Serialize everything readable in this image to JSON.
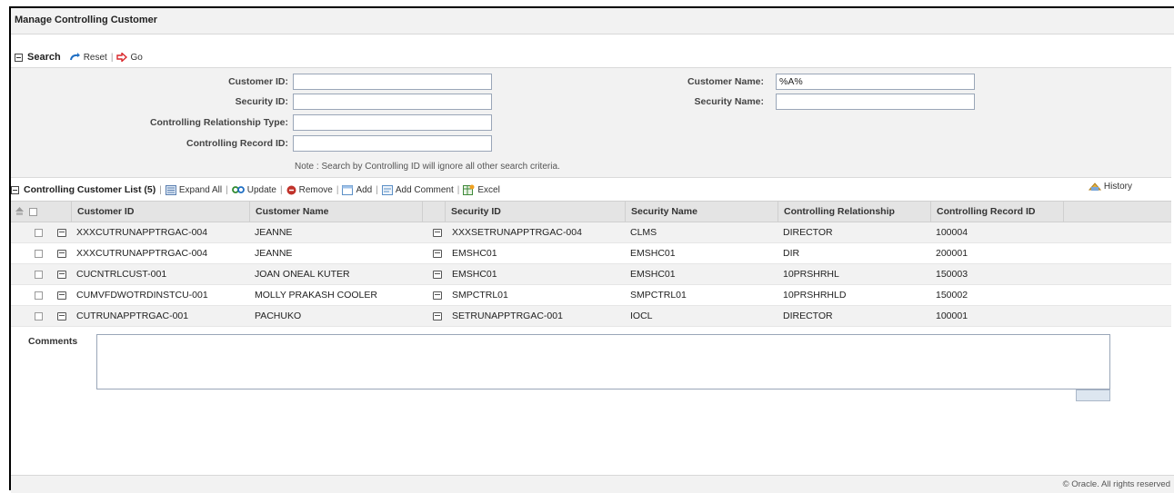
{
  "page": {
    "title": "Manage Controlling Customer"
  },
  "search": {
    "section_label": "Search",
    "reset_label": "Reset",
    "go_label": "Go",
    "fields": {
      "customer_id": {
        "label": "Customer ID:",
        "value": ""
      },
      "security_id": {
        "label": "Security ID:",
        "value": ""
      },
      "controlling_relationship_type": {
        "label": "Controlling Relationship Type:",
        "value": ""
      },
      "controlling_record_id": {
        "label": "Controlling Record ID:",
        "value": ""
      },
      "customer_name": {
        "label": "Customer Name:",
        "value": "%A%"
      },
      "security_name": {
        "label": "Security Name:",
        "value": ""
      }
    },
    "note": "Note : Search by Controlling ID will ignore all other search criteria."
  },
  "list": {
    "title": "Controlling Customer List (5)",
    "actions": {
      "expand_all": "Expand All",
      "update": "Update",
      "remove": "Remove",
      "add": "Add",
      "add_comment": "Add Comment",
      "excel": "Excel",
      "history": "History"
    },
    "columns": [
      "Customer ID",
      "Customer Name",
      "Security ID",
      "Security Name",
      "Controlling Relationship",
      "Controlling Record ID"
    ],
    "rows": [
      [
        "XXXCUTRUNAPPTRGAC-004",
        "JEANNE",
        "XXXSETRUNAPPTRGAC-004",
        "CLMS",
        "DIRECTOR",
        "100004"
      ],
      [
        "XXXCUTRUNAPPTRGAC-004",
        "JEANNE",
        "EMSHC01",
        "EMSHC01",
        "DIR",
        "200001"
      ],
      [
        "CUCNTRLCUST-001",
        "JOAN ONEAL KUTER",
        "EMSHC01",
        "EMSHC01",
        "10PRSHRHL",
        "150003"
      ],
      [
        "CUMVFDWOTRDINSTCU-001",
        "MOLLY PRAKASH COOLER",
        "SMPCTRL01",
        "SMPCTRL01",
        "10PRSHRHLD",
        "150002"
      ],
      [
        "CUTRUNAPPTRGAC-001",
        "PACHUKO",
        "SETRUNAPPTRGAC-001",
        "IOCL",
        "DIRECTOR",
        "100001"
      ]
    ]
  },
  "comments": {
    "label": "Comments",
    "value": ""
  },
  "footer": {
    "copyright": "© Oracle. All rights reserved"
  },
  "colors": {
    "panel_bg": "#f2f2f2",
    "header_bg": "#e4e4e4",
    "input_border": "#9aa6b8",
    "reset_icon": "#1f6fc4",
    "go_icon": "#d9262a",
    "update_icon": "#2f8a2f",
    "remove_icon": "#c0322b"
  }
}
